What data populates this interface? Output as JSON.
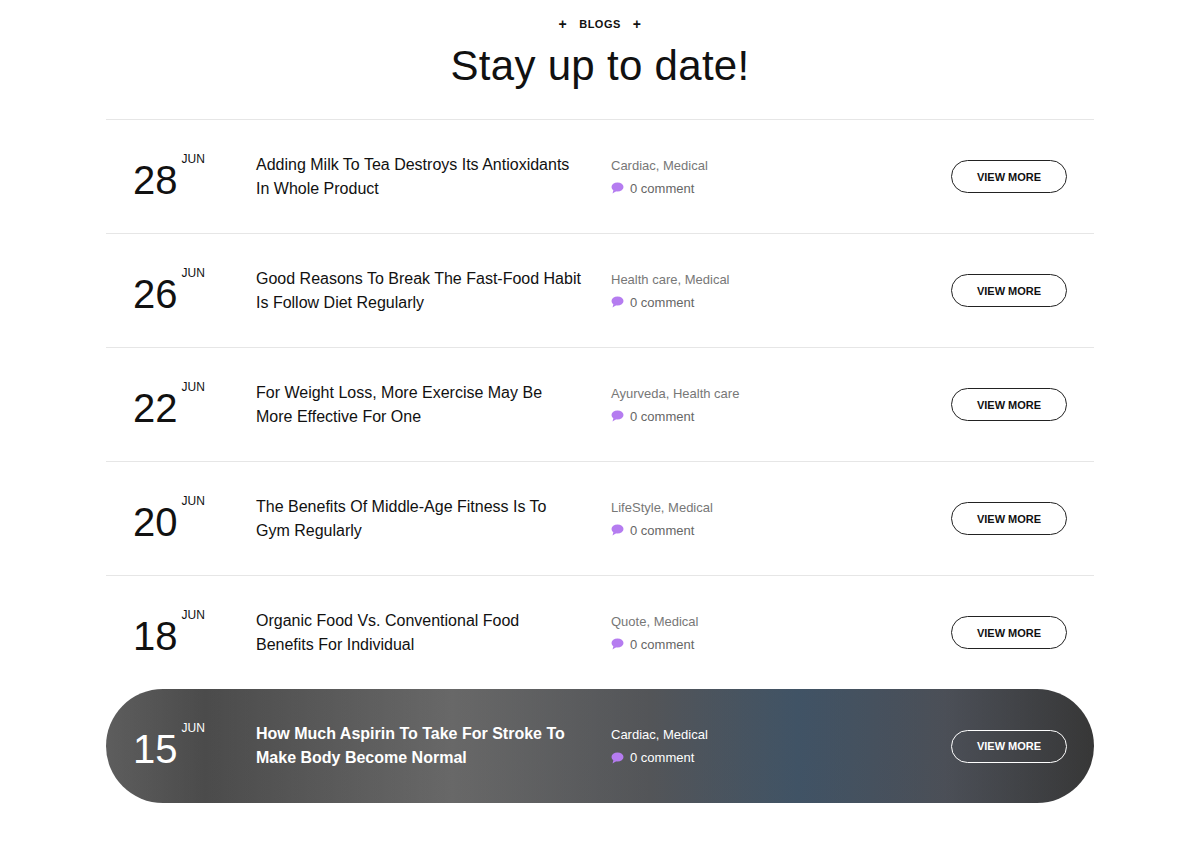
{
  "section": {
    "label": "BLOGS",
    "mark": "+"
  },
  "heading": "Stay up to date!",
  "posts": [
    {
      "day": "28",
      "month": "JUN",
      "title": "Adding Milk To Tea Destroys Its Antioxidants In Whole Product",
      "categories": "Cardiac, Medical",
      "comments": "0 comment",
      "button": "VIEW MORE",
      "selected": false
    },
    {
      "day": "26",
      "month": "JUN",
      "title": "Good Reasons To Break The Fast-Food Habit Is Follow Diet Regularly",
      "categories": "Health care, Medical",
      "comments": "0 comment",
      "button": "VIEW MORE",
      "selected": false
    },
    {
      "day": "22",
      "month": "JUN",
      "title": "For Weight Loss, More Exercise May Be More Effective For One",
      "categories": "Ayurveda, Health care",
      "comments": "0 comment",
      "button": "VIEW MORE",
      "selected": false
    },
    {
      "day": "20",
      "month": "JUN",
      "title": "The Benefits Of Middle-Age Fitness Is To Gym Regularly",
      "categories": "LifeStyle, Medical",
      "comments": "0 comment",
      "button": "VIEW MORE",
      "selected": false
    },
    {
      "day": "18",
      "month": "JUN",
      "title": "Organic Food Vs. Conventional Food Benefits For Individual",
      "categories": "Quote, Medical",
      "comments": "0 comment",
      "button": "VIEW MORE",
      "selected": false
    },
    {
      "day": "15",
      "month": "JUN",
      "title": "How Much Aspirin To Take For Stroke To Make Body Become Normal",
      "categories": "Cardiac, Medical",
      "comments": "0 comment",
      "button": "VIEW MORE",
      "selected": true
    }
  ]
}
